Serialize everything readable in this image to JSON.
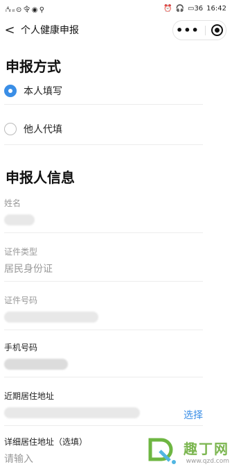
{
  "status_bar": {
    "time": "16:42",
    "battery": "36",
    "left_icons": "ᵢ⁴ᵢₗ ᵢₗ ⊙ 令 ◉ ⚲"
  },
  "nav": {
    "back": "<",
    "title": "个人健康申报",
    "menu": "•••"
  },
  "section_method": {
    "title": "申报方式",
    "options": [
      {
        "label": "本人填写",
        "checked": true
      },
      {
        "label": "他人代填",
        "checked": false
      }
    ]
  },
  "section_info": {
    "title": "申报人信息",
    "fields": {
      "name": {
        "label": "姓名"
      },
      "id_type": {
        "label": "证件类型",
        "value": "居民身份证"
      },
      "id_number": {
        "label": "证件号码"
      },
      "phone": {
        "label": "手机号码"
      },
      "address": {
        "label": "近期居住地址",
        "action": "选择"
      },
      "detail_address": {
        "label": "详细居住地址（选填）",
        "placeholder": "请输入"
      }
    }
  },
  "watermark": {
    "name": "趣丁网",
    "url": "www.qzd.com"
  }
}
